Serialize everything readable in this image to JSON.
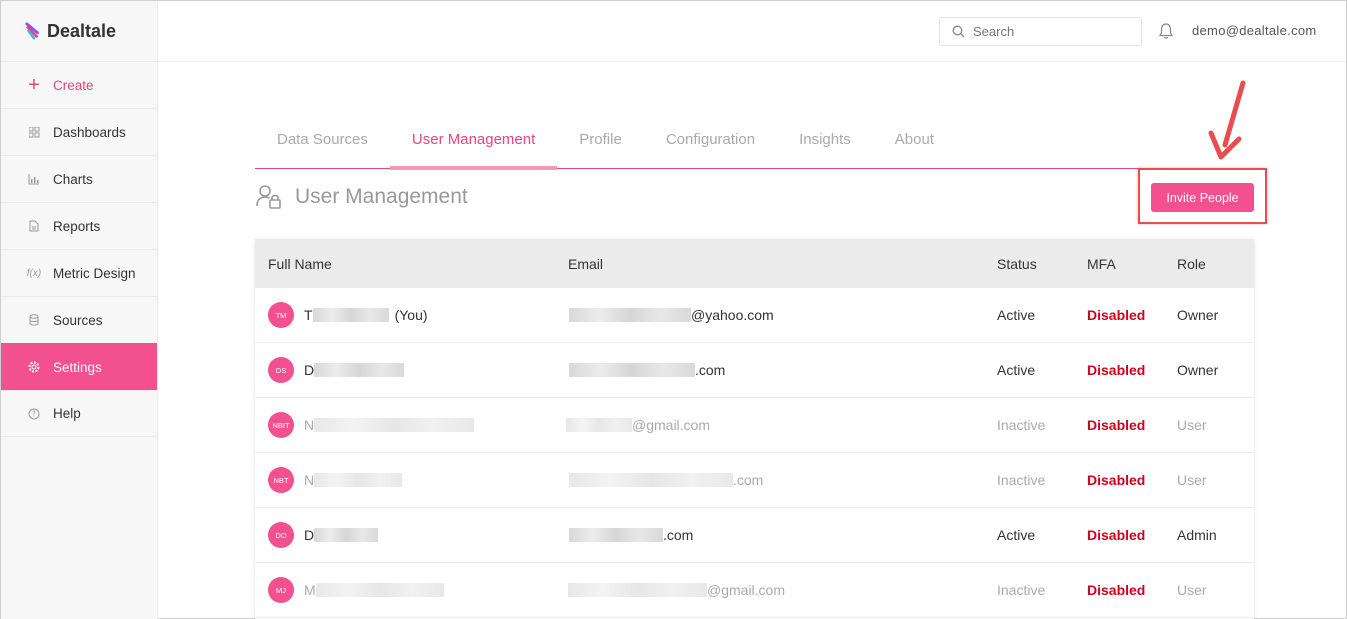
{
  "app": {
    "name": "Dealtale"
  },
  "sidebar": {
    "items": [
      {
        "label": "Create",
        "icon": "plus-icon"
      },
      {
        "label": "Dashboards",
        "icon": "grid-icon"
      },
      {
        "label": "Charts",
        "icon": "bar-chart-icon"
      },
      {
        "label": "Reports",
        "icon": "document-icon"
      },
      {
        "label": "Metric Design",
        "icon": "function-icon"
      },
      {
        "label": "Sources",
        "icon": "database-icon"
      },
      {
        "label": "Settings",
        "icon": "gear-icon"
      },
      {
        "label": "Help",
        "icon": "question-icon"
      }
    ],
    "active": "Settings"
  },
  "header": {
    "search_placeholder": "Search",
    "user_email": "demo@dealtale.com"
  },
  "tabs": [
    {
      "label": "Data Sources"
    },
    {
      "label": "User Management"
    },
    {
      "label": "Profile"
    },
    {
      "label": "Configuration"
    },
    {
      "label": "Insights"
    },
    {
      "label": "About"
    }
  ],
  "active_tab": "User Management",
  "section": {
    "title": "User Management",
    "invite_label": "Invite People"
  },
  "colors": {
    "accent": "#f2508e",
    "disabled": "#d0021b",
    "annotation": "#e94e4e"
  },
  "table": {
    "headers": {
      "name": "Full Name",
      "email": "Email",
      "status": "Status",
      "mfa": "MFA",
      "role": "Role"
    },
    "rows": [
      {
        "initials": "TM",
        "name_prefix": "T",
        "name_suffix": "(You)",
        "email_suffix": "@yahoo.com",
        "status": "Active",
        "mfa": "Disabled",
        "role": "Owner"
      },
      {
        "initials": "DS",
        "name_prefix": "D",
        "name_suffix": "",
        "email_suffix": ".com",
        "status": "Active",
        "mfa": "Disabled",
        "role": "Owner"
      },
      {
        "initials": "NBIT",
        "name_prefix": "N",
        "name_suffix": "",
        "email_suffix": "@gmail.com",
        "status": "Inactive",
        "mfa": "Disabled",
        "role": "User"
      },
      {
        "initials": "NBT",
        "name_prefix": "N",
        "name_suffix": "",
        "email_suffix": ".com",
        "status": "Inactive",
        "mfa": "Disabled",
        "role": "User"
      },
      {
        "initials": "DO",
        "name_prefix": "D",
        "name_suffix": "",
        "email_suffix": ".com",
        "status": "Active",
        "mfa": "Disabled",
        "role": "Admin"
      },
      {
        "initials": "MJ",
        "name_prefix": "M",
        "name_suffix": "",
        "email_suffix": "@gmail.com",
        "status": "Inactive",
        "mfa": "Disabled",
        "role": "User"
      }
    ]
  }
}
